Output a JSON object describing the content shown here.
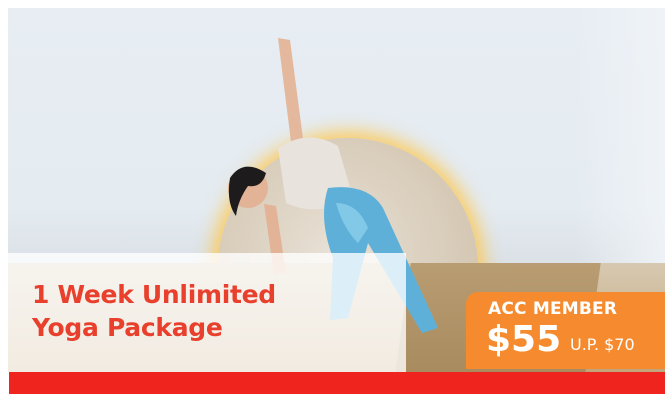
{
  "promo": {
    "title_line1": "1 Week Unlimited",
    "title_line2": "Yoga Package",
    "member_label": "ACC MEMBER",
    "member_price": "$55",
    "usual_price": "U.P. $70"
  },
  "colors": {
    "title": "#e8402c",
    "badge": "#f58b2e",
    "bottom_bar": "#f0241f",
    "arch_glow": "#ffc442"
  }
}
